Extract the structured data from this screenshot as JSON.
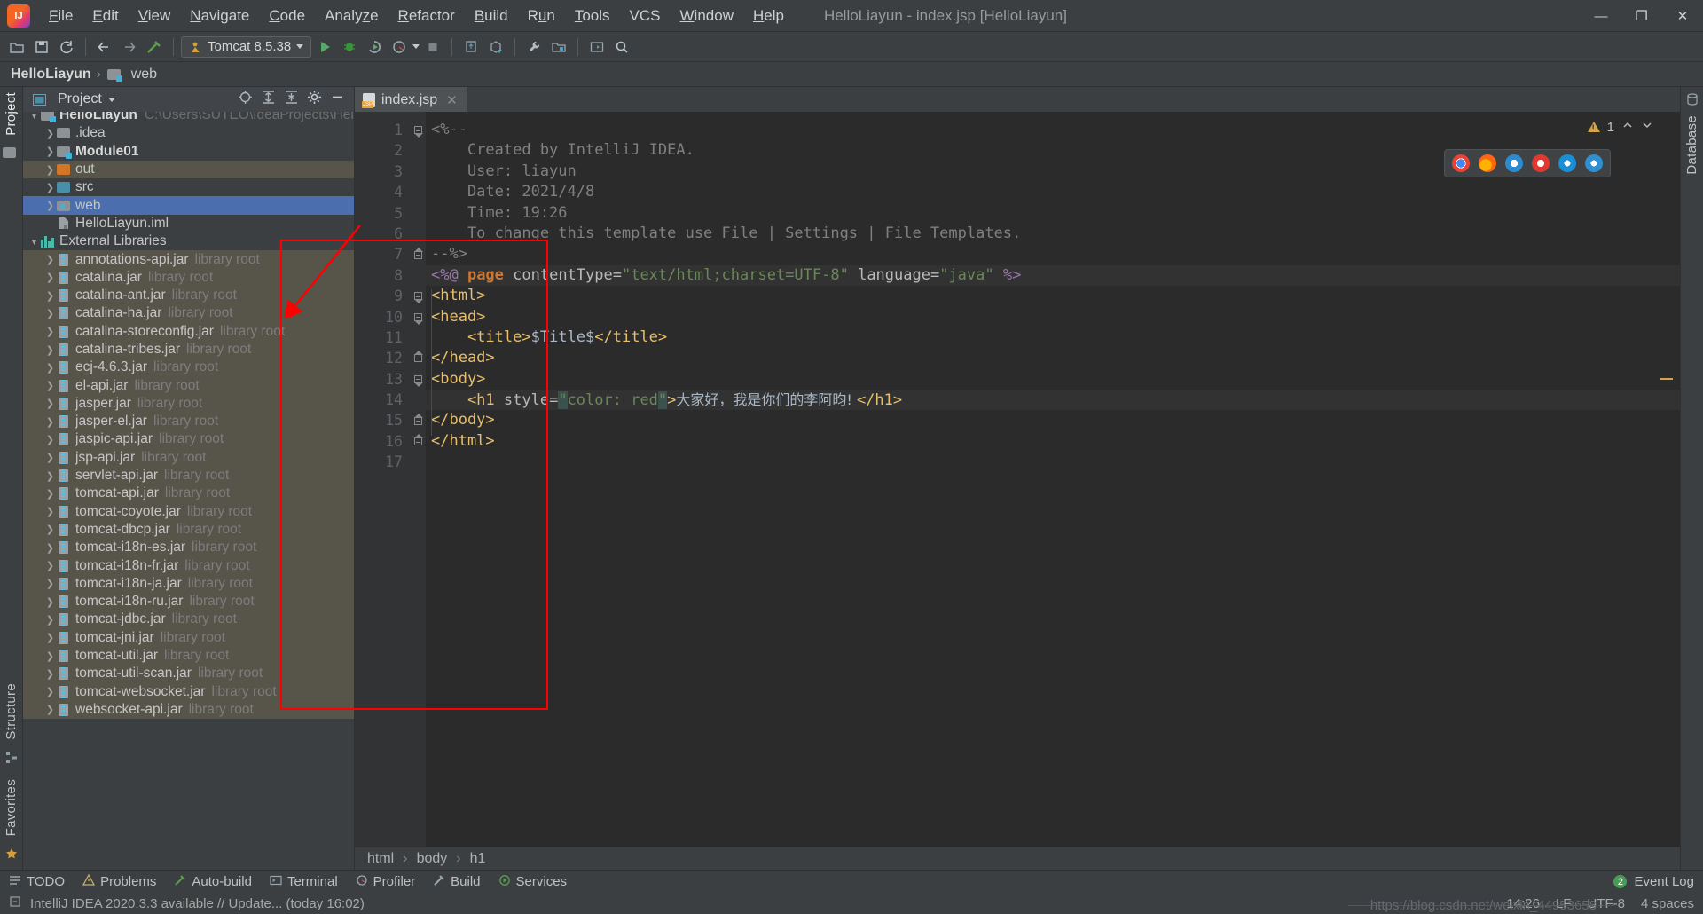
{
  "window": {
    "title": "HelloLiayun - index.jsp [HelloLiayun]",
    "minimize": "—",
    "maximize": "❐",
    "close": "✕"
  },
  "menu": [
    {
      "label": "File"
    },
    {
      "label": "Edit"
    },
    {
      "label": "View"
    },
    {
      "label": "Navigate"
    },
    {
      "label": "Code"
    },
    {
      "label": "Analyze"
    },
    {
      "label": "Refactor"
    },
    {
      "label": "Build"
    },
    {
      "label": "Run"
    },
    {
      "label": "Tools"
    },
    {
      "label": "VCS"
    },
    {
      "label": "Window"
    },
    {
      "label": "Help"
    }
  ],
  "toolbar": {
    "open_icon": "open-folder-icon",
    "save_icon": "save-icon",
    "sync_icon": "refresh-icon",
    "back_icon": "back-arrow-icon",
    "forward_icon": "forward-arrow-icon",
    "build_icon": "build-hammer-icon",
    "run_config": "Tomcat 8.5.38",
    "run_icon": "run-icon",
    "debug_icon": "debug-icon",
    "run_coverage_icon": "run-with-coverage-icon",
    "profile_icon": "profile-icon",
    "stop_icon": "stop-icon",
    "update_app_icon": "update-application-icon",
    "deploy_icon": "deploy-icon",
    "settings_icon": "wrench-settings-icon",
    "project_structure_icon": "project-structure-icon",
    "terminal_icon": "terminal-icon",
    "search_icon": "search-everywhere-icon"
  },
  "navbar": {
    "project": "HelloLiayun",
    "separator": "›",
    "node": "web"
  },
  "left_rail": {
    "project_label": "Project",
    "structure_label": "Structure",
    "favorites_label": "Favorites"
  },
  "right_rail": {
    "database_label": "Database"
  },
  "project_panel": {
    "title": "Project",
    "dropdown_icon": "chevron-down-icon",
    "actions": [
      "locate-icon",
      "expand-all-icon",
      "collapse-all-icon",
      "gear-icon",
      "hide-icon"
    ],
    "tree": [
      {
        "indent": 0,
        "arrow": "v",
        "icon": "module-folder",
        "label": "HelloLiayun",
        "bold": true,
        "path": "C:\\Users\\SUTEO\\IdeaProjects\\HelloLiayun",
        "state": "cut"
      },
      {
        "indent": 1,
        "arrow": ">",
        "icon": "folder-grey",
        "label": ".idea"
      },
      {
        "indent": 1,
        "arrow": ">",
        "icon": "module-folder",
        "label": "Module01",
        "bold": true
      },
      {
        "indent": 1,
        "arrow": ">",
        "icon": "folder-orange",
        "label": "out",
        "state": "hl"
      },
      {
        "indent": 1,
        "arrow": ">",
        "icon": "folder-teal",
        "label": "src"
      },
      {
        "indent": 1,
        "arrow": ">",
        "icon": "folder-web",
        "label": "web",
        "state": "sel"
      },
      {
        "indent": 1,
        "arrow": "",
        "icon": "iml-file",
        "label": "HelloLiayun.iml"
      },
      {
        "indent": 0,
        "arrow": "v",
        "icon": "libraries",
        "label": "External Libraries"
      },
      {
        "indent": 1,
        "arrow": ">",
        "icon": "jar",
        "label": "annotations-api.jar",
        "sub": "library root",
        "state": "hl"
      },
      {
        "indent": 1,
        "arrow": ">",
        "icon": "jar",
        "label": "catalina.jar",
        "sub": "library root",
        "state": "hl"
      },
      {
        "indent": 1,
        "arrow": ">",
        "icon": "jar",
        "label": "catalina-ant.jar",
        "sub": "library root",
        "state": "hl"
      },
      {
        "indent": 1,
        "arrow": ">",
        "icon": "jar",
        "label": "catalina-ha.jar",
        "sub": "library root",
        "state": "hl"
      },
      {
        "indent": 1,
        "arrow": ">",
        "icon": "jar",
        "label": "catalina-storeconfig.jar",
        "sub": "library root",
        "state": "hl"
      },
      {
        "indent": 1,
        "arrow": ">",
        "icon": "jar",
        "label": "catalina-tribes.jar",
        "sub": "library root",
        "state": "hl"
      },
      {
        "indent": 1,
        "arrow": ">",
        "icon": "jar",
        "label": "ecj-4.6.3.jar",
        "sub": "library root",
        "state": "hl"
      },
      {
        "indent": 1,
        "arrow": ">",
        "icon": "jar",
        "label": "el-api.jar",
        "sub": "library root",
        "state": "hl"
      },
      {
        "indent": 1,
        "arrow": ">",
        "icon": "jar",
        "label": "jasper.jar",
        "sub": "library root",
        "state": "hl"
      },
      {
        "indent": 1,
        "arrow": ">",
        "icon": "jar",
        "label": "jasper-el.jar",
        "sub": "library root",
        "state": "hl"
      },
      {
        "indent": 1,
        "arrow": ">",
        "icon": "jar",
        "label": "jaspic-api.jar",
        "sub": "library root",
        "state": "hl"
      },
      {
        "indent": 1,
        "arrow": ">",
        "icon": "jar",
        "label": "jsp-api.jar",
        "sub": "library root",
        "state": "hl"
      },
      {
        "indent": 1,
        "arrow": ">",
        "icon": "jar",
        "label": "servlet-api.jar",
        "sub": "library root",
        "state": "hl"
      },
      {
        "indent": 1,
        "arrow": ">",
        "icon": "jar",
        "label": "tomcat-api.jar",
        "sub": "library root",
        "state": "hl"
      },
      {
        "indent": 1,
        "arrow": ">",
        "icon": "jar",
        "label": "tomcat-coyote.jar",
        "sub": "library root",
        "state": "hl"
      },
      {
        "indent": 1,
        "arrow": ">",
        "icon": "jar",
        "label": "tomcat-dbcp.jar",
        "sub": "library root",
        "state": "hl"
      },
      {
        "indent": 1,
        "arrow": ">",
        "icon": "jar",
        "label": "tomcat-i18n-es.jar",
        "sub": "library root",
        "state": "hl"
      },
      {
        "indent": 1,
        "arrow": ">",
        "icon": "jar",
        "label": "tomcat-i18n-fr.jar",
        "sub": "library root",
        "state": "hl"
      },
      {
        "indent": 1,
        "arrow": ">",
        "icon": "jar",
        "label": "tomcat-i18n-ja.jar",
        "sub": "library root",
        "state": "hl"
      },
      {
        "indent": 1,
        "arrow": ">",
        "icon": "jar",
        "label": "tomcat-i18n-ru.jar",
        "sub": "library root",
        "state": "hl"
      },
      {
        "indent": 1,
        "arrow": ">",
        "icon": "jar",
        "label": "tomcat-jdbc.jar",
        "sub": "library root",
        "state": "hl"
      },
      {
        "indent": 1,
        "arrow": ">",
        "icon": "jar",
        "label": "tomcat-jni.jar",
        "sub": "library root",
        "state": "hl"
      },
      {
        "indent": 1,
        "arrow": ">",
        "icon": "jar",
        "label": "tomcat-util.jar",
        "sub": "library root",
        "state": "hl"
      },
      {
        "indent": 1,
        "arrow": ">",
        "icon": "jar",
        "label": "tomcat-util-scan.jar",
        "sub": "library root",
        "state": "hl"
      },
      {
        "indent": 1,
        "arrow": ">",
        "icon": "jar",
        "label": "tomcat-websocket.jar",
        "sub": "library root",
        "state": "hl"
      },
      {
        "indent": 1,
        "arrow": ">",
        "icon": "jar",
        "label": "websocket-api.jar",
        "sub": "library root",
        "state": "hl"
      }
    ]
  },
  "editor": {
    "tab": {
      "label": "index.jsp",
      "icon": "jsp-file-icon",
      "close_icon": "close-icon"
    },
    "inspection": {
      "warning_count": "1",
      "warning_icon": "warning-triangle-icon",
      "up_icon": "chevron-up-icon",
      "down_icon": "chevron-down-icon"
    },
    "browsers": [
      "chrome-icon",
      "firefox-icon",
      "opera-icon",
      "safari-icon",
      "edge-icon",
      "ie-icon"
    ],
    "line_numbers": [
      "1",
      "2",
      "3",
      "4",
      "5",
      "6",
      "7",
      "8",
      "9",
      "10",
      "11",
      "12",
      "13",
      "14",
      "15",
      "16",
      "17"
    ],
    "breakpoint_line": "14",
    "current_line": "14",
    "lines": [
      {
        "n": 1,
        "segments": [
          {
            "t": "<%--",
            "c": "cmt"
          }
        ]
      },
      {
        "n": 2,
        "segments": [
          {
            "t": "    Created by IntelliJ IDEA.",
            "c": "cmt"
          }
        ]
      },
      {
        "n": 3,
        "segments": [
          {
            "t": "    User: liayun",
            "c": "cmt"
          }
        ]
      },
      {
        "n": 4,
        "segments": [
          {
            "t": "    Date: 2021/4/8",
            "c": "cmt"
          }
        ]
      },
      {
        "n": 5,
        "segments": [
          {
            "t": "    Time: 19:26",
            "c": "cmt"
          }
        ]
      },
      {
        "n": 6,
        "segments": [
          {
            "t": "    To change this template use File | Settings | File Templates.",
            "c": "cmt"
          }
        ]
      },
      {
        "n": 7,
        "segments": [
          {
            "t": "--%>",
            "c": "cmt"
          }
        ]
      },
      {
        "n": 8,
        "segments": [
          {
            "t": "<%@ ",
            "c": "el"
          },
          {
            "t": "page",
            "c": "kw"
          },
          {
            "t": " contentType=",
            "c": "attr"
          },
          {
            "t": "\"text/html;charset=UTF-8\"",
            "c": "str"
          },
          {
            "t": " language=",
            "c": "attr"
          },
          {
            "t": "\"java\"",
            "c": "str"
          },
          {
            "t": " %>",
            "c": "el"
          }
        ]
      },
      {
        "n": 9,
        "segments": [
          {
            "t": "<html>",
            "c": "tag"
          }
        ]
      },
      {
        "n": 10,
        "segments": [
          {
            "t": "<head>",
            "c": "tag"
          }
        ]
      },
      {
        "n": 11,
        "segments": [
          {
            "t": "    <title>",
            "c": "tag"
          },
          {
            "t": "$Title$",
            "c": "val"
          },
          {
            "t": "</title>",
            "c": "tag"
          }
        ]
      },
      {
        "n": 12,
        "segments": [
          {
            "t": "</head>",
            "c": "tag"
          }
        ]
      },
      {
        "n": 13,
        "segments": [
          {
            "t": "<body>",
            "c": "tag"
          }
        ]
      },
      {
        "n": 14,
        "segments": [
          {
            "t": "    <h1 ",
            "c": "tag"
          },
          {
            "t": "style=",
            "c": "attr"
          },
          {
            "t": "\"",
            "c": "str hl-str"
          },
          {
            "t": "color: red",
            "c": "str"
          },
          {
            "t": "\"",
            "c": "str hl-str"
          },
          {
            "t": ">",
            "c": "tag"
          },
          {
            "t": "大家好，我是你们的李阿昀! ",
            "c": "cjk"
          },
          {
            "t": "</h1>",
            "c": "tag"
          }
        ]
      },
      {
        "n": 15,
        "segments": [
          {
            "t": "</body>",
            "c": "tag"
          }
        ]
      },
      {
        "n": 16,
        "segments": [
          {
            "t": "</html>",
            "c": "tag"
          }
        ]
      },
      {
        "n": 17,
        "segments": [
          {
            "t": "",
            "c": "txt"
          }
        ]
      }
    ],
    "breadcrumbs": [
      "html",
      "body",
      "h1"
    ]
  },
  "tool_windows": [
    {
      "label": "TODO",
      "icon": "todo-icon"
    },
    {
      "label": "Problems",
      "icon": "problems-icon"
    },
    {
      "label": "Auto-build",
      "icon": "auto-build-icon"
    },
    {
      "label": "Terminal",
      "icon": "terminal-icon"
    },
    {
      "label": "Profiler",
      "icon": "profiler-icon"
    },
    {
      "label": "Build",
      "icon": "build-icon"
    },
    {
      "label": "Services",
      "icon": "services-icon"
    }
  ],
  "event_log": {
    "label": "Event Log",
    "count": "2"
  },
  "status_bar": {
    "message": "IntelliJ IDEA 2020.3.3 available // Update... (today 16:02)",
    "position": "14:26",
    "line_sep": "LF",
    "encoding": "UTF-8",
    "indent": "4 spaces",
    "lock_icon": "read-only-icon"
  },
  "annotations": {
    "watermark": "https://blog.csdn.net/weixin_44953658",
    "rect_color": "#ff0000",
    "arrow_color": "#ff0000"
  }
}
